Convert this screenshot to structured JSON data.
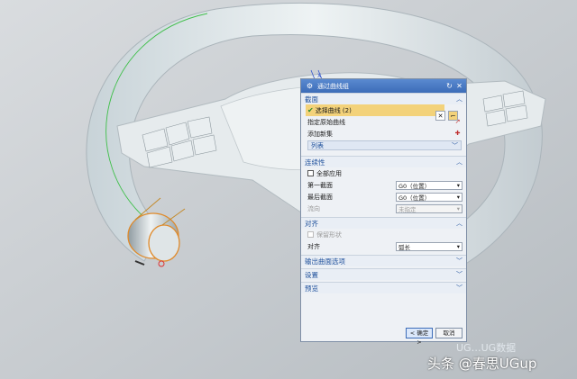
{
  "dialog": {
    "title": "通过曲线组",
    "sections": {
      "section": {
        "label": "截面",
        "select_curve": "选择曲线 (2)",
        "specify_origin": "指定原始曲线",
        "add_new_set": "添加新集",
        "list": "列表"
      },
      "continuity": {
        "label": "连续性",
        "apply_all": "全部应用",
        "first_section_label": "第一截面",
        "first_section_value": "G0（位置）",
        "last_section_label": "最后截面",
        "last_section_value": "G0（位置）",
        "flow_label": "流向",
        "flow_value": "未指定"
      },
      "alignment": {
        "label": "对齐",
        "keep_shape": "保留形状",
        "align_label": "对齐",
        "align_value": "弧长"
      },
      "output_options": {
        "label": "输出曲面选项"
      },
      "settings": {
        "label": "设置"
      },
      "preview": {
        "label": "预览"
      }
    },
    "buttons": {
      "ok": "< 确定 >",
      "cancel": "取消"
    }
  },
  "watermark": "头条 @春思UGup",
  "watermark_faint": "UG…UG数据"
}
